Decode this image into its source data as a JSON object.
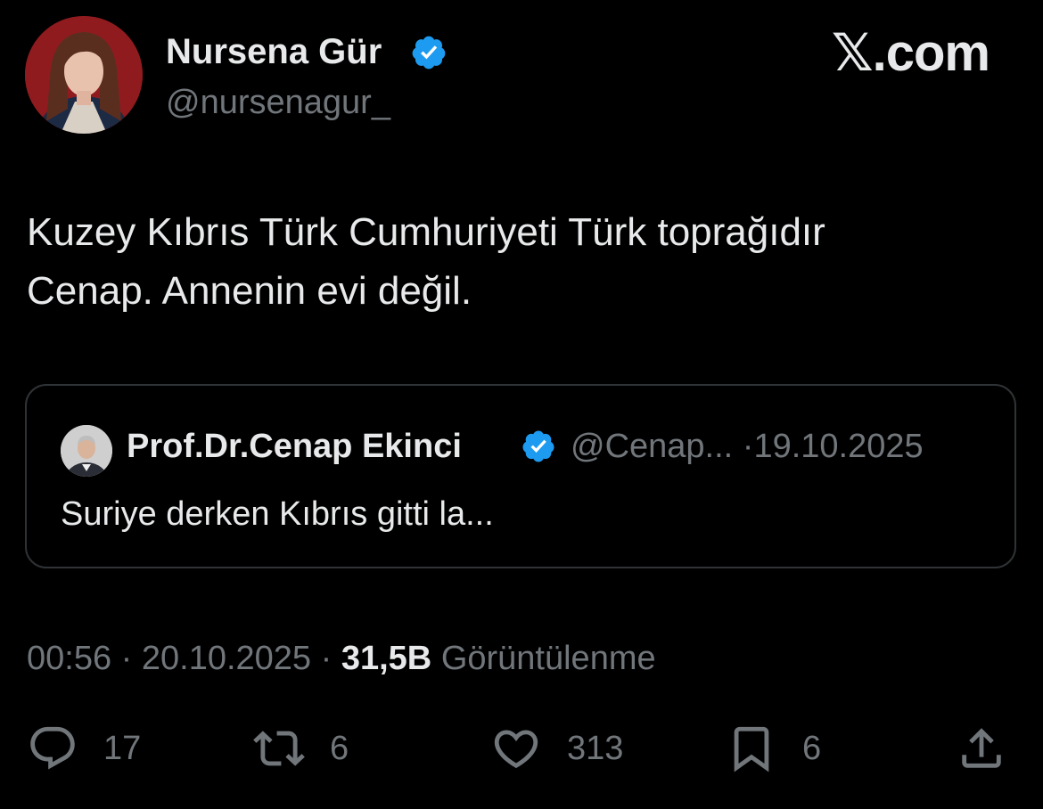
{
  "author": {
    "name": "Nursena Gür",
    "handle": "@nursenagur_",
    "verified": true
  },
  "brand": "𝕏.com",
  "tweet": {
    "text": "Kuzey Kıbrıs Türk Cumhuriyeti Türk toprağıdır\nCenap. Annenin evi değil."
  },
  "quote": {
    "name": "Prof.Dr.Cenap Ekinci",
    "verified": true,
    "handle": "@Cenap...",
    "separator": "·",
    "date": "19.10.2025",
    "text": "Suriye derken Kıbrıs gitti la..."
  },
  "meta": {
    "time": "00:56",
    "date": "20.10.2025",
    "views_count": "31,5B",
    "views_label": "Görüntülenme",
    "separator": "·"
  },
  "actions": {
    "replies": "17",
    "reposts": "6",
    "likes": "313",
    "bookmarks": "6"
  },
  "icons": {
    "verified": "verified-badge-icon",
    "reply": "speech-bubble-icon",
    "repost": "repost-arrows-icon",
    "like": "heart-icon",
    "bookmark": "bookmark-icon",
    "share": "share-upload-icon"
  },
  "colors": {
    "background": "#000000",
    "text": "#e7e9ea",
    "secondary": "#71767b",
    "verified": "#1d9bf0",
    "border": "#2f3336"
  }
}
